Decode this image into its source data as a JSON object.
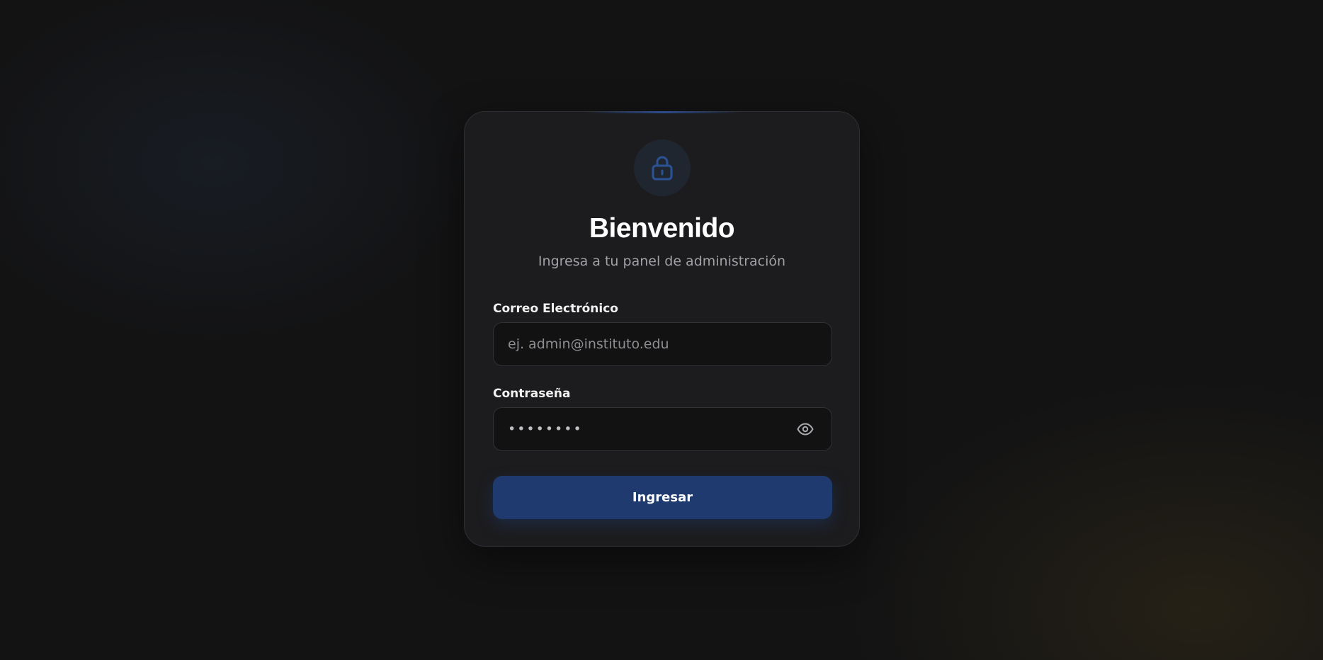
{
  "login": {
    "title": "Bienvenido",
    "subtitle": "Ingresa a tu panel de administración",
    "email_label": "Correo Electrónico",
    "email_placeholder": "ej. admin@instituto.edu",
    "email_value": "",
    "password_label": "Contraseña",
    "password_value": "••••••••",
    "password_toggle_icon": "eye-icon",
    "submit_label": "Ingresar",
    "header_icon": "lock-icon"
  },
  "colors": {
    "background": "#131314",
    "card": "#1c1c1e",
    "accent": "#1e3a6e",
    "icon_accent": "#2c5296",
    "input_bg": "#121213"
  }
}
